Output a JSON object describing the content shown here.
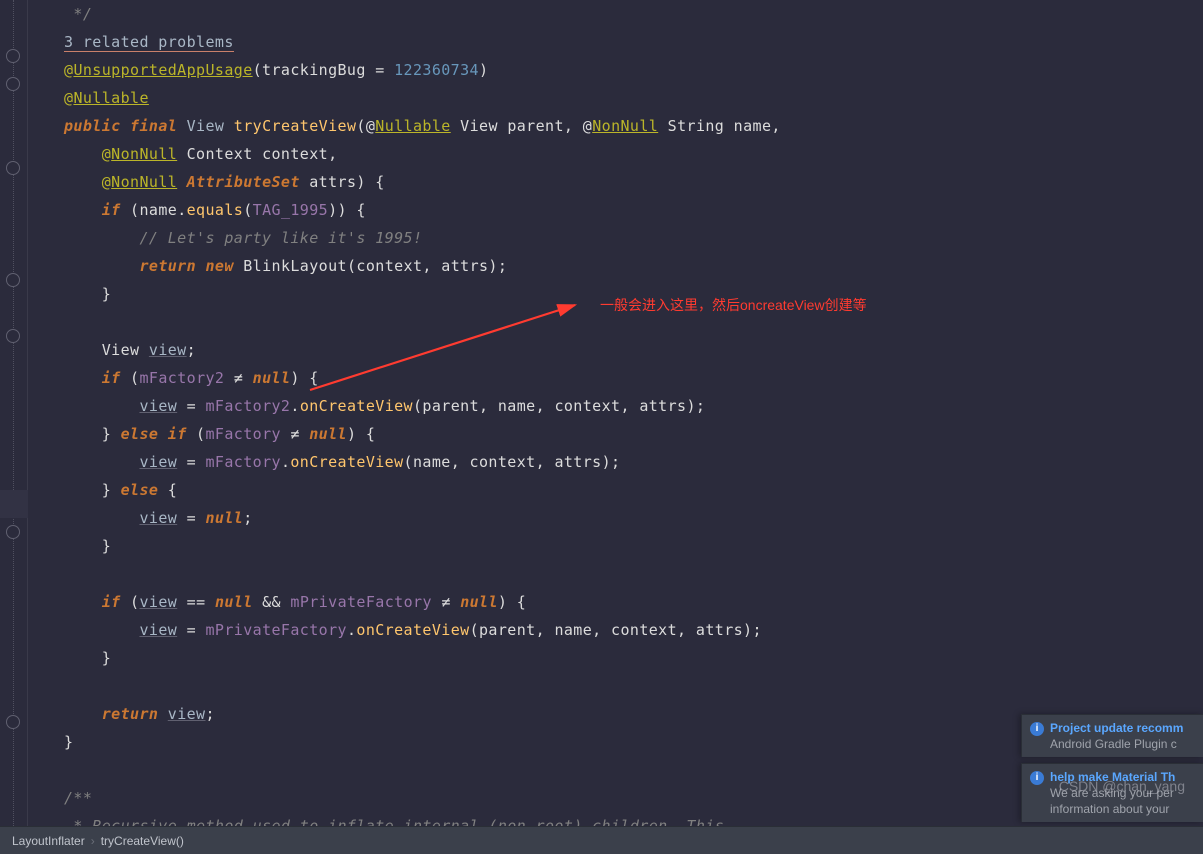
{
  "problems_hint": "3 related problems",
  "annotation_text": "一般会进入这里，然后oncreateView创建等",
  "watermark": "CSDN @chan_yang",
  "notifications": {
    "n1_title": "Project update recomm",
    "n1_body": "Android Gradle Plugin c",
    "n2_title": "help make Material Th",
    "n2_body1": "We are asking your per",
    "n2_body2": "information about your"
  },
  "breadcrumb": {
    "a": "LayoutInflater",
    "b": "tryCreateView()"
  },
  "code": {
    "c0": " */",
    "anno1_at": "@",
    "anno1": "UnsupportedAppUsage",
    "anno1_args_l": "(trackingBug = ",
    "anno1_num": "122360734",
    "anno1_args_r": ")",
    "anno2": "Nullable",
    "kw_public": "public",
    "kw_final": "final",
    "t_view": "View",
    "f_try": "tryCreateView",
    "p1": "(@",
    "a_null": "Nullable",
    "p1b": " View parent, @",
    "a_nn": "NonNull",
    "p1c": " String name,",
    "p2a": "@",
    "p2b": " Context context,",
    "p3a": "@",
    "p3b": " AttributeSet",
    "p3c": " attrs) {",
    "if1": "if",
    "if1b": " (name.",
    "if1m": "equals",
    "if1c": "(",
    "if1f": "TAG_1995",
    "if1d": ")) {",
    "cm1": "// Let's party like it's 1995!",
    "ret1": "return",
    "new1": "new",
    "blink": "BlinkLayout",
    "blinkargs": "(context, attrs);",
    "rb1": "}",
    "decl": "View ",
    "declv": "view",
    "decls": ";",
    "if2": "if",
    "if2a": " (",
    "mf2": "mFactory2",
    "neq": " ≠ ",
    "null": "null",
    "rb2": ") {",
    "vw": "view",
    "asg": " = ",
    "mf2b": "mFactory2",
    "dot": ".",
    "ocv": "onCreateView",
    "args4": "(parent, name, context, attrs);",
    "elseif": "else if",
    "mf1": "mFactory",
    "args3": "(name, context, attrs);",
    "else": "else",
    "nullsemi": ";",
    "if3": "if",
    "eqeq": " == ",
    "andand": " && ",
    "mpf": "mPrivateFactory",
    "retv": "return",
    "semiret": ";",
    "cm2a": "/**",
    "cm2b": " * Recursive method used to inflate internal (non-root) children. This"
  }
}
